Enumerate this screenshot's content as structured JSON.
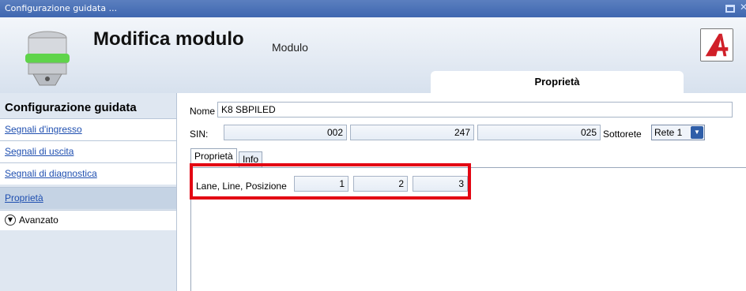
{
  "window": {
    "title": "Configurazione guidata ..."
  },
  "header": {
    "title": "Modifica modulo",
    "subtitle": "Modulo",
    "tab_label": "Proprietà"
  },
  "sidebar": {
    "title": "Configurazione guidata",
    "items": [
      {
        "label": "Segnali d'ingresso"
      },
      {
        "label": "Segnali di uscita"
      },
      {
        "label": "Segnali di diagnostica"
      },
      {
        "label": "Proprietà"
      }
    ],
    "advanced_label": "Avanzato"
  },
  "form": {
    "name_label": "Nome",
    "name_value": "K8 SBPILED",
    "sin_label": "SIN:",
    "sin_values": [
      "002",
      "247",
      "025"
    ],
    "subnet_label": "Sottorete",
    "subnet_value": "Rete 1"
  },
  "tabs": [
    {
      "label": "Proprietà"
    },
    {
      "label": "Info"
    }
  ],
  "properties": {
    "label": "Lane, Line, Posizione",
    "values": [
      "1",
      "2",
      "3"
    ]
  },
  "colors": {
    "titlebar": "#3f67b0",
    "highlight": "#e30613",
    "link": "#1f4fb0"
  }
}
